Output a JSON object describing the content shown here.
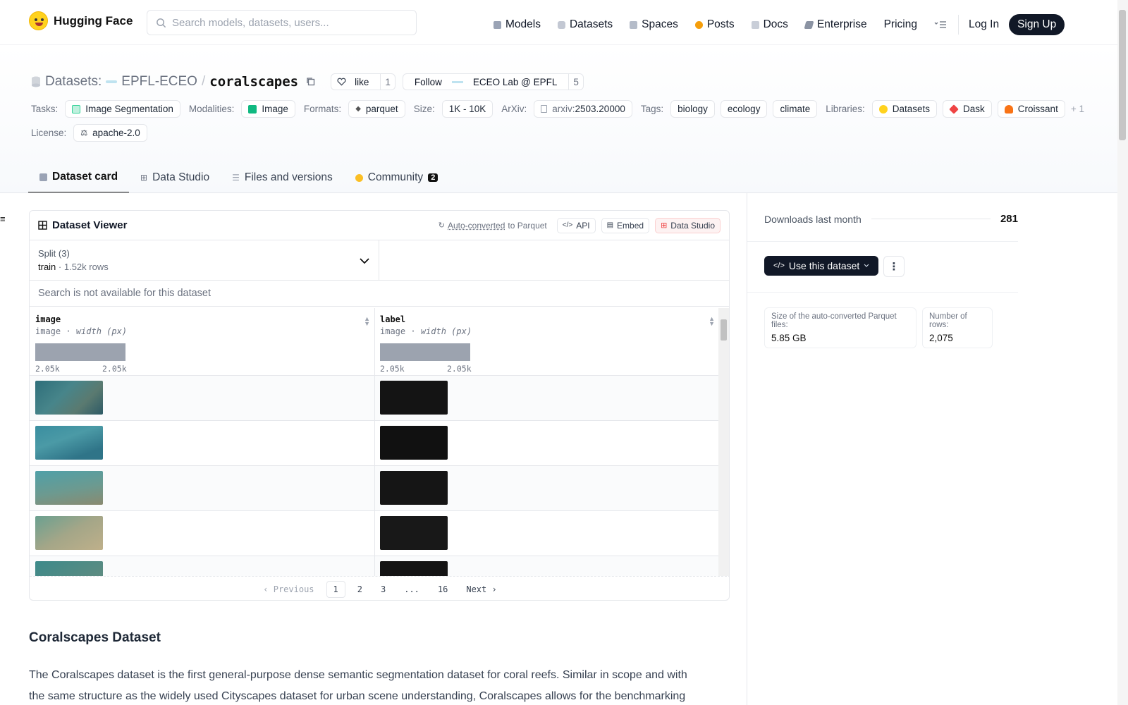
{
  "nav": {
    "brand": "Hugging Face",
    "search_placeholder": "Search models, datasets, users...",
    "links": [
      "Models",
      "Datasets",
      "Spaces",
      "Posts",
      "Docs",
      "Enterprise",
      "Pricing"
    ],
    "login": "Log In",
    "signup": "Sign Up"
  },
  "repo": {
    "section": "Datasets:",
    "org": "EPFL-ECEO",
    "slash": "/",
    "name": "coralscapes",
    "like": "like",
    "like_count": "1",
    "follow": "Follow",
    "follow_org": "ECEO Lab @ EPFL",
    "follow_count": "5"
  },
  "tags": {
    "tasks_label": "Tasks:",
    "task": "Image Segmentation",
    "modalities_label": "Modalities:",
    "modality": "Image",
    "formats_label": "Formats:",
    "format": "parquet",
    "size_label": "Size:",
    "size": "1K - 10K",
    "arxiv_label": "ArXiv:",
    "arxiv_prefix": "arxiv:",
    "arxiv_id": "2503.20000",
    "tags_label": "Tags:",
    "tag_list": [
      "biology",
      "ecology",
      "climate"
    ],
    "libraries_label": "Libraries:",
    "libraries": [
      "Datasets",
      "Dask",
      "Croissant"
    ],
    "libraries_more": "+ 1",
    "license_label": "License:",
    "license": "apache-2.0"
  },
  "tabs": [
    "Dataset card",
    "Data Studio",
    "Files and versions",
    "Community"
  ],
  "community_badge": "2",
  "viewer": {
    "title": "Dataset Viewer",
    "auto_converted": "Auto-converted",
    "to_parquet": "to Parquet",
    "api": "API",
    "embed": "Embed",
    "data_studio": "Data Studio",
    "split_label": "Split (3)",
    "split_name": "train",
    "split_rows": "1.52k rows",
    "search_disabled": "Search is not available for this dataset",
    "columns": [
      {
        "name": "image",
        "type": "image",
        "hint": "width (px)",
        "min": "2.05k",
        "max": "2.05k"
      },
      {
        "name": "label",
        "type": "image",
        "hint": "width (px)",
        "min": "2.05k",
        "max": "2.05k"
      }
    ],
    "pager": {
      "prev": "Previous",
      "pages": [
        "1",
        "2",
        "3",
        "...",
        "16"
      ],
      "next": "Next"
    }
  },
  "readme": {
    "title": "Coralscapes Dataset",
    "body": "The Coralscapes dataset is the first general-purpose dense semantic segmentation dataset for coral reefs. Similar in scope and with the same structure as the widely used Cityscapes dataset for urban scene understanding, Coralscapes allows for the benchmarking"
  },
  "sidebar": {
    "downloads_label": "Downloads last month",
    "downloads": "281",
    "use_dataset": "Use this dataset",
    "parquet_size_label": "Size of the auto-converted Parquet files:",
    "parquet_size": "5.85 GB",
    "rows_label": "Number of rows:",
    "rows": "2,075"
  },
  "colors": {
    "accent_dark": "#111827",
    "muted": "#6b7280",
    "border": "#e5e7eb"
  }
}
